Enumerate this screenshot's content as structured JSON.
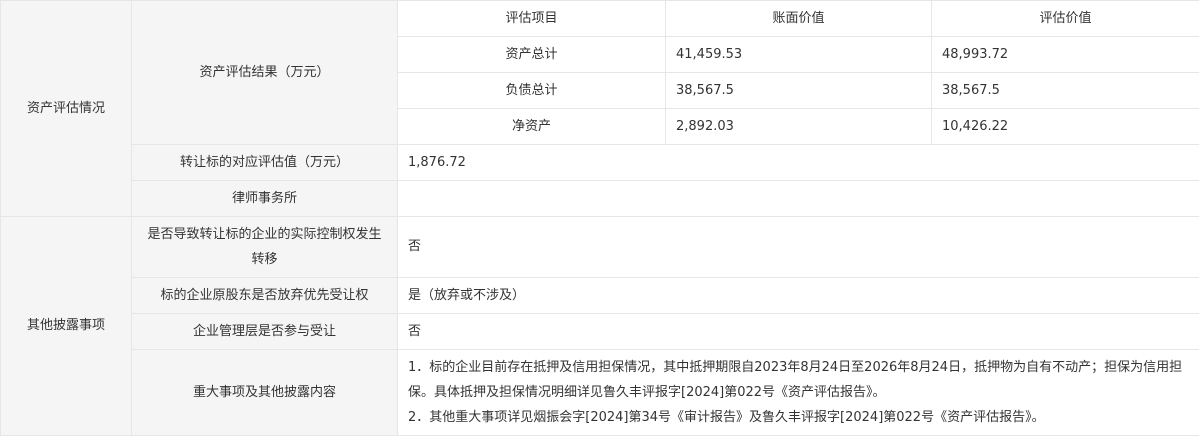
{
  "section_asset": {
    "title": "资产评估情况",
    "result_label": "资产评估结果（万元）",
    "columns": [
      "评估项目",
      "账面价值",
      "评估价值"
    ],
    "rows": [
      {
        "item": "资产总计",
        "book": "41,459.53",
        "appraised": "48,993.72"
      },
      {
        "item": "负债总计",
        "book": "38,567.5",
        "appraised": "38,567.5"
      },
      {
        "item": "净资产",
        "book": "2,892.03",
        "appraised": "10,426.22"
      }
    ],
    "target_value_label": "转让标的对应评估值（万元）",
    "target_value": "1,876.72",
    "law_firm_label": "律师事务所",
    "law_firm": ""
  },
  "section_other": {
    "title": "其他披露事项",
    "control_change_label": "是否导致转让标的企业的实际控制权发生转移",
    "control_change_value": "否",
    "shareholder_waive_label": "标的企业原股东是否放弃优先受让权",
    "shareholder_waive_value": "是（放弃或不涉及）",
    "management_label": "企业管理层是否参与受让",
    "management_value": "否",
    "major_items_label": "重大事项及其他披露内容",
    "major_items_line1": "1．标的企业目前存在抵押及信用担保情况，其中抵押期限自2023年8月24日至2026年8月24日，抵押物为自有不动产；担保为信用担保。具体抵押及担保情况明细详见鲁久丰评报字[2024]第022号《资产评估报告》。",
    "major_items_line2": "2．其他重大事项详见烟振会字[2024]第34号《审计报告》及鲁久丰评报字[2024]第022号《资产评估报告》。"
  }
}
